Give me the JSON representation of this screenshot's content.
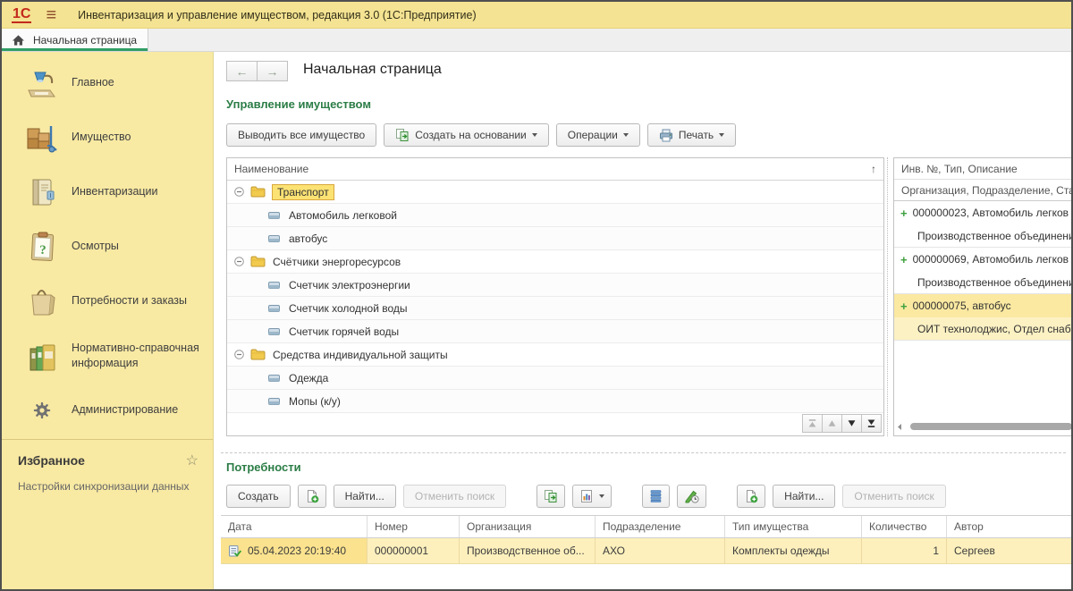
{
  "window": {
    "logo": "1С",
    "title": "Инвентаризация и управление имуществом, редакция 3.0  (1С:Предприятие)"
  },
  "tabs": [
    {
      "label": "Начальная страница",
      "icon": "home-icon",
      "active": true
    }
  ],
  "sidebar": {
    "items": [
      {
        "id": "home",
        "label": "Главное",
        "icon": "lamp-icon"
      },
      {
        "id": "property",
        "label": "Имущество",
        "icon": "boxes-icon"
      },
      {
        "id": "inventories",
        "label": "Инвентаризации",
        "icon": "book-icon"
      },
      {
        "id": "inspections",
        "label": "Осмотры",
        "icon": "clipboard-icon"
      },
      {
        "id": "needs-orders",
        "label": "Потребности и заказы",
        "icon": "bag-icon"
      },
      {
        "id": "reference-info",
        "label": "Нормативно-справочная информация",
        "icon": "binders-icon"
      },
      {
        "id": "administration",
        "label": "Администрирование",
        "icon": "gear-icon"
      }
    ],
    "favorites": {
      "title": "Избранное",
      "star_icon": "star-icon",
      "items": [
        {
          "label": "Настройки синхронизации данных"
        }
      ]
    }
  },
  "main": {
    "page_title": "Начальная страница",
    "property_section": {
      "heading": "Управление имуществом",
      "toolbar": [
        {
          "name": "show-all-property-button",
          "label": "Выводить все имущество"
        },
        {
          "name": "create-based-on-button",
          "label": "Создать на основании",
          "icon": "copy-icon",
          "dropdown": true
        },
        {
          "name": "operations-button",
          "label": "Операции",
          "dropdown": true
        },
        {
          "name": "print-button",
          "label": "Печать",
          "icon": "printer-icon",
          "dropdown": true
        }
      ],
      "tree": {
        "header": "Наименование",
        "sort_icon": "sort-asc-icon",
        "rows": [
          {
            "type": "group",
            "label": "Транспорт",
            "selected": true
          },
          {
            "type": "item",
            "label": "Автомобиль легковой"
          },
          {
            "type": "item",
            "label": "автобус"
          },
          {
            "type": "group",
            "label": "Счётчики энергоресурсов"
          },
          {
            "type": "item",
            "label": "Счетчик электроэнергии"
          },
          {
            "type": "item",
            "label": "Счетчик холодной воды"
          },
          {
            "type": "item",
            "label": "Счетчик горячей воды"
          },
          {
            "type": "group",
            "label": "Средства индивидуальной защиты"
          },
          {
            "type": "item",
            "label": "Одежда"
          },
          {
            "type": "item",
            "label": "Мопы (к/у)"
          }
        ]
      },
      "detail": {
        "header_line1": "Инв. №, Тип, Описание",
        "header_line2": "Организация, Подразделение, Стат",
        "rows": [
          {
            "line1": "000000023, Автомобиль легков",
            "line2": "Производственное объединени",
            "selected": false
          },
          {
            "line1": "000000069, Автомобиль легков",
            "line2": "Производственное объединени",
            "selected": false
          },
          {
            "line1": "000000075, автобус",
            "line2": "ОИТ технолоджис, Отдел снаб",
            "selected": true
          }
        ]
      }
    },
    "needs_section": {
      "heading": "Потребности",
      "toolbar": [
        {
          "name": "create-button",
          "label": "Создать"
        },
        {
          "name": "create-new-icon-button",
          "icon": "doc-plus-icon"
        },
        {
          "name": "find-button",
          "label": "Найти..."
        },
        {
          "name": "cancel-search-button",
          "label": "Отменить поиск",
          "disabled": true
        },
        {
          "name": "create-based-on-icon-button",
          "icon": "copy-icon",
          "group": true
        },
        {
          "name": "reports-icon-button",
          "icon": "report-icon",
          "dropdown": true
        },
        {
          "name": "list-settings-icon-button",
          "icon": "list-icon",
          "group": true
        },
        {
          "name": "edit-schedule-icon-button",
          "icon": "pen-clock-icon"
        },
        {
          "name": "create-order-icon-button",
          "icon": "doc-plus-icon",
          "group": true
        },
        {
          "name": "find2-button",
          "label": "Найти..."
        },
        {
          "name": "cancel-search2-button",
          "label": "Отменить поиск",
          "disabled": true
        }
      ],
      "table": {
        "columns": [
          "Дата",
          "Номер",
          "Организация",
          "Подразделение",
          "Тип имущества",
          "Количество",
          "Автор"
        ],
        "rows": [
          {
            "icon": "doc-check-icon",
            "date": "05.04.2023 20:19:40",
            "number": "000000001",
            "organization": "Производственное об...",
            "department": "АХО",
            "property_type": "Комплекты одежды",
            "quantity": "1",
            "author": "Сергеев",
            "selected": true
          }
        ]
      }
    }
  }
}
